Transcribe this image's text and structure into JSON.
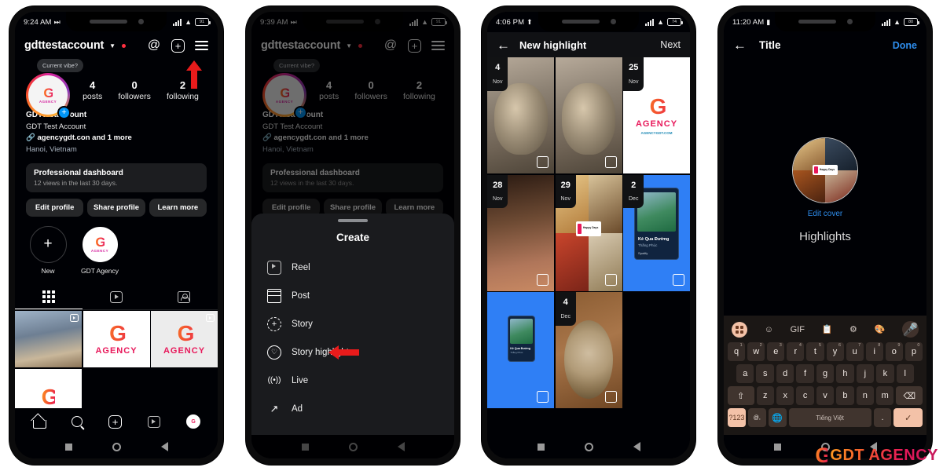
{
  "phones": [
    {
      "id": "phone1",
      "status": {
        "time": "9:24 AM",
        "extra_icon": "forward-icon",
        "signal": "signal-icon",
        "wifi": "wifi-icon",
        "battery": "91"
      },
      "profile": {
        "username": "gdttestaccount",
        "vibe_bubble": "Current vibe?",
        "stats": [
          {
            "n": "4",
            "l": "posts"
          },
          {
            "n": "0",
            "l": "followers"
          },
          {
            "n": "2",
            "l": "following"
          }
        ],
        "display_name": "GDTtestaccount",
        "full_name": "GDT Test Account",
        "link": "agencygdt.con and 1 more",
        "location": "Hanoi, Vietnam",
        "dashboard_title": "Professional dashboard",
        "dashboard_sub": "12 views in the last 30 days.",
        "buttons": [
          "Edit profile",
          "Share profile",
          "Learn more"
        ],
        "highlights": [
          {
            "label": "New",
            "type": "add"
          },
          {
            "label": "GDT Agency",
            "type": "photo"
          }
        ],
        "tabs": [
          "grid-tab",
          "reels-tab",
          "tagged-tab"
        ],
        "logo_mark": "G",
        "logo_word": "AGENCY",
        "bottom_nav": [
          "home-icon",
          "search-icon",
          "create-icon",
          "reels-icon",
          "profile-avatar"
        ]
      }
    },
    {
      "id": "phone2",
      "status": {
        "time": "9:39 AM",
        "battery": "91"
      },
      "sheet": {
        "title": "Create",
        "items": [
          {
            "label": "Reel",
            "icon": "reel-icon"
          },
          {
            "label": "Post",
            "icon": "post-grid-icon"
          },
          {
            "label": "Story",
            "icon": "story-plus-icon"
          },
          {
            "label": "Story highlight",
            "icon": "story-highlight-icon",
            "highlighted": true
          },
          {
            "label": "Live",
            "icon": "live-icon"
          },
          {
            "label": "Ad",
            "icon": "ad-trend-icon"
          }
        ]
      }
    },
    {
      "id": "phone3",
      "status": {
        "time": "4:06 PM",
        "battery": "74"
      },
      "header": {
        "back": "back-arrow-icon",
        "title": "New highlight",
        "action": "Next"
      },
      "grid": [
        {
          "day": "4",
          "month": "Nov",
          "kind": "cat",
          "checked": false
        },
        {
          "day": "",
          "month": "",
          "kind": "cat",
          "checked": false
        },
        {
          "day": "25",
          "month": "Nov",
          "kind": "whitelogo",
          "checked": false,
          "caption": "AGENCY",
          "sub": "AGENCYGDT.COM"
        },
        {
          "day": "28",
          "month": "Nov",
          "kind": "restaurant",
          "checked": false
        },
        {
          "day": "29",
          "month": "Nov",
          "kind": "foodgrid",
          "checked": false
        },
        {
          "day": "2",
          "month": "Dec",
          "kind": "spotify",
          "checked": false,
          "track": "Kẻ Qua Đường",
          "artist": "Thắng Phúc",
          "service": "Spotify"
        },
        {
          "day": "",
          "month": "",
          "kind": "spotify2",
          "checked": false,
          "track": "Kẻ Qua Đường",
          "artist": "Thắng Phúc"
        },
        {
          "day": "4",
          "month": "Dec",
          "kind": "coffee",
          "checked": false
        }
      ]
    },
    {
      "id": "phone4",
      "status": {
        "time": "11:20 AM",
        "battery": "80"
      },
      "header": {
        "back": "back-arrow-icon",
        "title": "Title",
        "action": "Done"
      },
      "cover": {
        "edit_label": "Edit cover",
        "highlight_title": "Highlights",
        "badge_text": "Happy Days"
      },
      "keyboard": {
        "toolbar": [
          "keyboard-switch-icon",
          "sticker-icon",
          "GIF",
          "clipboard-icon",
          "settings-icon",
          "theme-icon",
          "mic-icon"
        ],
        "row1": [
          {
            "k": "q",
            "sup": "1"
          },
          {
            "k": "w",
            "sup": "2"
          },
          {
            "k": "e",
            "sup": "3"
          },
          {
            "k": "r",
            "sup": "4"
          },
          {
            "k": "t",
            "sup": "5"
          },
          {
            "k": "y",
            "sup": "6"
          },
          {
            "k": "u",
            "sup": "7"
          },
          {
            "k": "i",
            "sup": "8"
          },
          {
            "k": "o",
            "sup": "9"
          },
          {
            "k": "p",
            "sup": "0"
          }
        ],
        "row2": [
          "a",
          "s",
          "d",
          "f",
          "g",
          "h",
          "j",
          "k",
          "l"
        ],
        "row3": [
          "z",
          "x",
          "c",
          "v",
          "b",
          "n",
          "m"
        ],
        "shift": "shift-icon",
        "backspace": "backspace-icon",
        "num_key": "?123",
        "sym_key": "@,",
        "globe": "language-globe-icon",
        "space": "Tiếng Việt",
        "period": ".",
        "enter": "enter-check-icon"
      }
    }
  ],
  "watermark": {
    "mark": "G",
    "text": "GDT AGENCY"
  },
  "colors": {
    "accent_blue": "#0095f6",
    "link_blue": "#2e8eee",
    "arrow_red": "#e81b1b",
    "brand_orange": "#ff9c20",
    "brand_pink": "#e8185a",
    "keyboard_accent": "#f3c2a8"
  }
}
